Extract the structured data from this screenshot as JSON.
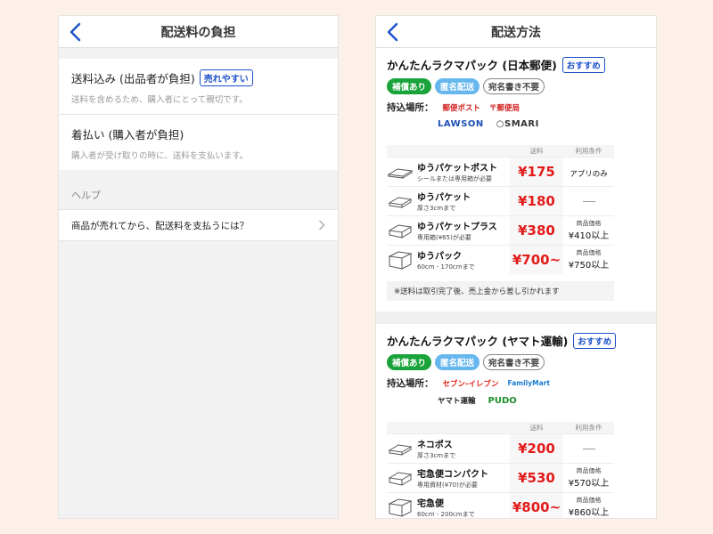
{
  "left": {
    "title": "配送料の負担",
    "options": [
      {
        "label": "送料込み (出品者が負担)",
        "badge": "売れやすい",
        "desc": "送料を含めるため、購入者にとって親切です。"
      },
      {
        "label": "着払い (購入者が負担)",
        "badge": "",
        "desc": "購入者が受け取りの時に、送料を支払います。"
      }
    ],
    "help_heading": "ヘルプ",
    "help_item": "商品が売れてから、配送料を支払うには？"
  },
  "right": {
    "title": "配送方法",
    "table_headers": {
      "price": "送料",
      "cond": "利用条件"
    },
    "services": [
      {
        "name": "かんたんラクマパック (日本郵便)",
        "recommend": "おすすめ",
        "tags": [
          "補償あり",
          "匿名配送",
          "宛名書き不要"
        ],
        "dropoff_label": "持込場所：",
        "logos_row1": [
          "郵便ポスト",
          "郵便局"
        ],
        "logos_row2": [
          "LAWSON",
          "SMARI"
        ],
        "items": [
          {
            "name": "ゆうパケットポスト",
            "sub": "シールまたは専用箱が必要",
            "price": "¥175",
            "cond_text": "アプリのみ",
            "cond_label": "",
            "cond_value": ""
          },
          {
            "name": "ゆうパケット",
            "sub": "厚さ3cmまで",
            "price": "¥180",
            "cond_text": "",
            "cond_label": "",
            "cond_value": ""
          },
          {
            "name": "ゆうパケットプラス",
            "sub": "専用箱(¥65)が必要",
            "price": "¥380",
            "cond_text": "",
            "cond_label": "商品価格",
            "cond_value": "¥410以上"
          },
          {
            "name": "ゆうパック",
            "sub": "60cm - 170cmまで",
            "price": "¥700~",
            "cond_text": "",
            "cond_label": "商品価格",
            "cond_value": "¥750以上"
          }
        ],
        "note": "※送料は取引完了後、売上金から差し引かれます"
      },
      {
        "name": "かんたんラクマパック (ヤマト運輸)",
        "recommend": "おすすめ",
        "tags": [
          "補償あり",
          "匿名配送",
          "宛名書き不要"
        ],
        "dropoff_label": "持込場所：",
        "logos_row1": [
          "セブン-イレブン",
          "FamilyMart"
        ],
        "logos_row2": [
          "ヤマト運輸",
          "PUDO"
        ],
        "items": [
          {
            "name": "ネコポス",
            "sub": "厚さ3cmまで",
            "price": "¥200",
            "cond_text": "",
            "cond_label": "",
            "cond_value": ""
          },
          {
            "name": "宅急便コンパクト",
            "sub": "専用資材(¥70)が必要",
            "price": "¥530",
            "cond_text": "",
            "cond_label": "商品価格",
            "cond_value": "¥570以上"
          },
          {
            "name": "宅急便",
            "sub": "60cm - 200cmまで",
            "price": "¥800~",
            "cond_text": "",
            "cond_label": "商品価格",
            "cond_value": "¥860以上"
          }
        ]
      }
    ]
  }
}
